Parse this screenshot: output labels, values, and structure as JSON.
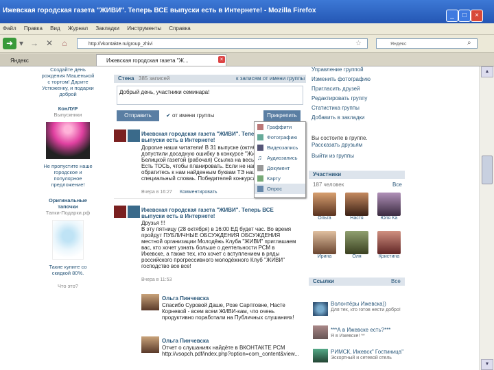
{
  "window": {
    "title": "Ижевская городская газета \"ЖИВИ\". Теперь ВСЕ выпуски есть в Интернете! - Mozilla Firefox"
  },
  "menu": [
    "Файл",
    "Правка",
    "Вид",
    "Журнал",
    "Закладки",
    "Инструменты",
    "Справка"
  ],
  "navbar": {
    "url": "http://vkontakte.ru/group_zhivi",
    "search_placeholder": "Яндекс"
  },
  "tabs": [
    {
      "label": "Яндекс"
    },
    {
      "label": "Ижевская городская газета \"Ж...",
      "active": true
    }
  ],
  "left_column": {
    "top_text": "Создайте день рождения Машенькой с тортом! Дарите Устюженку, и подарки доброй",
    "ad1_title": "КонЛУР",
    "ad1_sub": "Выпускники",
    "ad1_text": "Не пропустите наше городское и популярное предложение!",
    "ad2_title": "Оригинальные тапочки",
    "ad2_sub": "Тапки-Подарки.рф",
    "ad2_text": "Такие купите со скидкой 80%.",
    "more": "Что это?"
  },
  "wall": {
    "header": "Стена",
    "count": "385 записей",
    "link_all": "к записям от имени группы",
    "input_value": "Добрый день, участники семинара!",
    "send_button": "Отправить",
    "as_group_label": "от имени группы",
    "attach_button": "Прикрепить",
    "attach_menu": [
      "Граффити",
      "Фотографию",
      "Видеозапись",
      "Аудиозапись",
      "Документ",
      "Карту",
      "Опрос"
    ]
  },
  "posts": [
    {
      "author": "Ижевская городская газета \"ЖИВИ\". Теперь ВСЕ выпуски есть в Интернете!",
      "text": "Дорогие наши читатели! В 31 выпуске (октябрь) допустили досадную ошибку в конкурсе \"Живи\" с Белицкой газетой (рабочая) Ссылка на весь выпуск. Есть ТОСЬ, чтобы планировать. Если не нашли, то обратитесь к нам найденным буквам ТЭ наш новый специальный словаь. Победителей конкурса",
      "meta": "Вчера в 16:27",
      "reply": "Комментировать"
    },
    {
      "author": "Ижевская городская газета \"ЖИВИ\". Теперь ВСЕ выпуски есть в Интернете!",
      "subtitle": "Друзья !!!",
      "text": "В эту пятницу (28 октября) в 16:00 ЕД будет час. Во время пройдут ПУБЛИЧНЫЕ ОБСУЖДЕНИЯ ОБСУЖДЕНИЯ местной организации Молодёжь Клуба \"ЖИВИ\" приглашаем вас, кто хочет узнать больше о деятельности РСМ в Ижевске, а также тех, кто хочет с вступлением в ряды российского прогрессивного молодёжного Клуб \"ЖИВИ\" господство все все!",
      "meta": "Вчера в 11:53"
    }
  ],
  "comments": [
    {
      "author": "Ольга Пинчевска",
      "text": "Спасибо Суровой Даше, Розе Сарптовне, Насте Корневой - всем всем ЖИВИ-кам, что очень продуктивно поработали на Публичных слушаниях! :))"
    },
    {
      "author": "Ольга Пинчевска",
      "text": "Отчет о слушаниях найдёте в ВКОНТАКТЕ РСМ http://vsopch.pdf/index.php?option=com_content&view..."
    }
  ],
  "right_column": {
    "links": [
      "Управление группой",
      "Изменить фотографию",
      "Пригласить друзей",
      "Редактировать группу",
      "Статистика группы",
      "Добавить в закладки"
    ],
    "member_status": "Вы состоите в группе.",
    "invite_link": "Рассказать друзьям",
    "leave_link": "Выйти из группы",
    "members_header": "Участники",
    "members_count": "187 человек",
    "members_all": "Все",
    "friends": [
      "Ольга",
      "Настя",
      "Юля Ка",
      "Ирина",
      "Оля",
      "Кристина"
    ],
    "links_header": "Ссылки",
    "links_all": "Все",
    "ext_links": [
      {
        "title": "Волонтёры Ижевска))",
        "desc": "Для тех, кто готов нести добро!"
      },
      {
        "title": "***А в Ижевске есть?***",
        "desc": "Я в Ижевске! **"
      },
      {
        "title": "РИМСК, Ижевск\" Гостиница\"",
        "desc": "Эскортный и сетевой отель"
      }
    ]
  }
}
